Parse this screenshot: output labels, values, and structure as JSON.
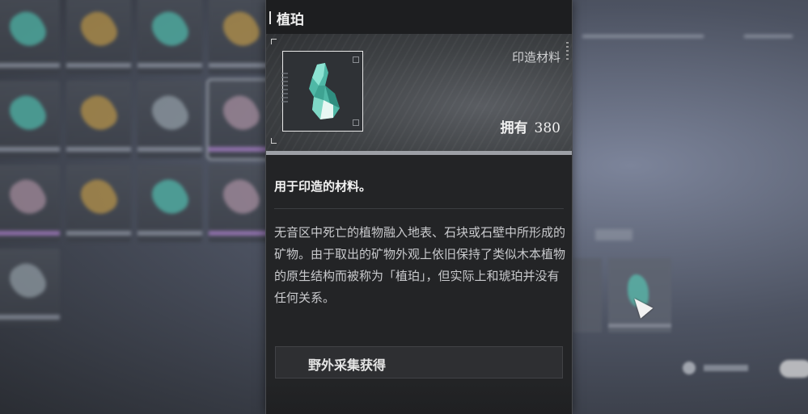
{
  "item": {
    "name": "植珀",
    "type": "印造材料",
    "owned_label": "拥有",
    "owned_count": "380",
    "icon": "green-crystal-icon",
    "short_description": "用于印造的材料。",
    "long_description": "无音区中死亡的植物融入地表、石块或石壁中所形成的矿物。由于取出的矿物外观上依旧保持了类似木本植物的原生结构而被称为「植珀」，但实际上和琥珀并没有任何关系。",
    "source_label": "野外采集获得"
  },
  "colors": {
    "crystal": "#5fc9b6",
    "panel": "#232426"
  }
}
